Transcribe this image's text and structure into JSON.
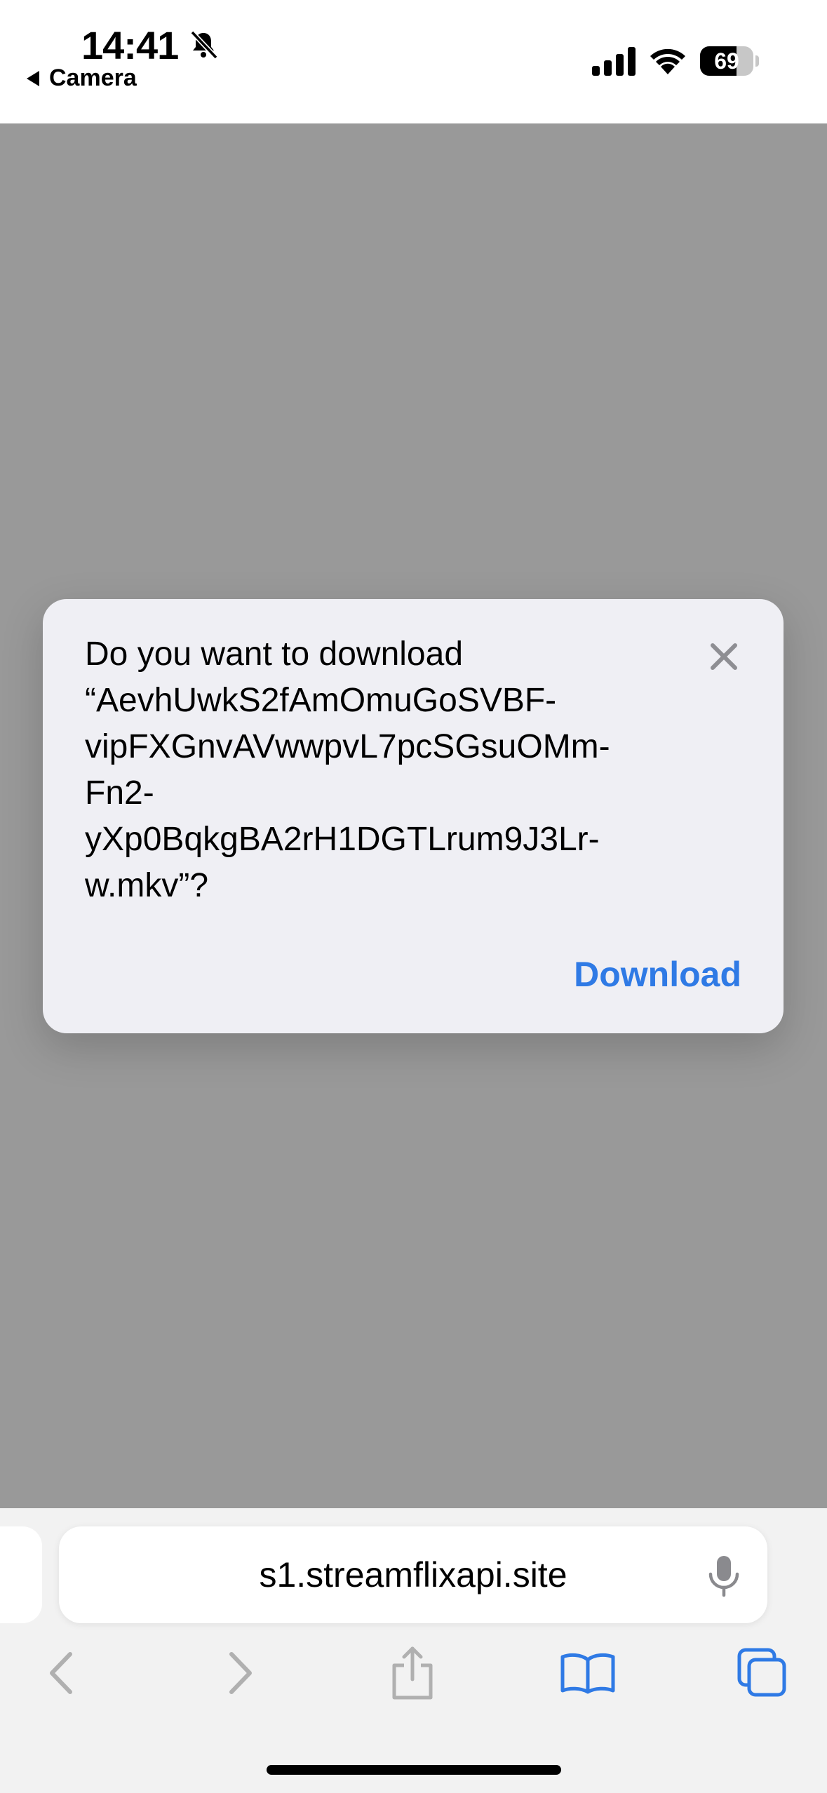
{
  "status_bar": {
    "time": "14:41",
    "back_app": "Camera",
    "battery_level": "69",
    "battery_fraction": 0.69,
    "icons": [
      "bell-slash-icon",
      "cellular-signal-icon",
      "wifi-icon",
      "battery-icon"
    ]
  },
  "dialog": {
    "message": "Do you want to download\n“AevhUwkS2fAmOmuGoSVBF-\nvipFXGnvAVwwpvL7pcSGsuOMm-\nFn2-\nyXp0BqkgBA2rH1DGTLrum9J3Lr-\nw.mkv”?",
    "download_label": "Download",
    "close_icon": "xmark-icon"
  },
  "address_bar": {
    "url": "s1.streamflixapi.site",
    "mic_icon": "microphone-icon"
  },
  "toolbar": {
    "icons": [
      "back-chevron-icon",
      "forward-chevron-icon",
      "share-icon",
      "bookmarks-icon",
      "tabs-icon"
    ]
  },
  "colors": {
    "accent": "#2f7ae5",
    "dim_background": "#999999",
    "dialog_background": "#efeff4",
    "disabled_icon": "#b0b0b0"
  }
}
